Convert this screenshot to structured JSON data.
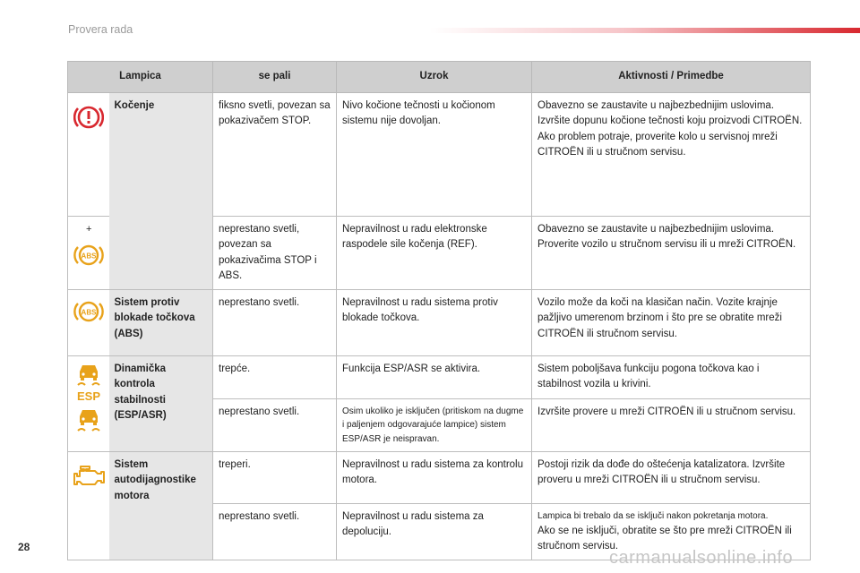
{
  "page": {
    "header_title": "Provera rada",
    "page_number": "28",
    "watermark": "carmanualsonline.info"
  },
  "table": {
    "headers": [
      "Lampica",
      "se pali",
      "Uzrok",
      "Aktivnosti / Primedbe"
    ],
    "brake": {
      "name": "Kočenje",
      "row1": {
        "se_pali": "fiksno svetli, povezan sa pokazivačem STOP.",
        "uzrok": "Nivo kočione tečnosti u kočionom sistemu nije dovoljan.",
        "aktivnosti": "Obavezno se zaustavite u najbezbednijim uslovima. Izvršite dopunu kočione tečnosti koju proizvodi CITROËN. Ako problem potraje, proverite kolo u servisnoj mreži CITROËN ili u stručnom servisu."
      },
      "plus": "+",
      "row2": {
        "se_pali": "neprestano svetli, povezan sa pokazivačima STOP i ABS.",
        "uzrok": "Nepravilnost u radu elektronske raspodele sile kočenja (REF).",
        "aktivnosti": "Obavezno se zaustavite u najbezbednijim uslovima. Proverite vozilo u stručnom servisu ili u mreži CITROËN."
      }
    },
    "abs": {
      "name": "Sistem protiv blokade točkova (ABS)",
      "se_pali": "neprestano svetli.",
      "uzrok": "Nepravilnost u radu sistema protiv blokade točkova.",
      "aktivnosti": "Vozilo može da koči na klasičan način. Vozite krajnje pažljivo umerenom brzinom i što pre se obratite mreži CITROËN ili stručnom servisu."
    },
    "esp": {
      "name": "Dinamička kontrola stabilnosti (ESP/ASR)",
      "icon_label": "ESP",
      "row1": {
        "se_pali": "trepće.",
        "uzrok": "Funkcija ESP/ASR se aktivira.",
        "aktivnosti": "Sistem poboljšava funkciju pogona točkova kao i stabilnost vozila u krivini."
      },
      "row2": {
        "se_pali": "neprestano svetli.",
        "uzrok": "Osim ukoliko je isključen (pritiskom na dugme i paljenjem odgovarajuće lampice) sistem ESP/ASR je neispravan.",
        "aktivnosti": "Izvršite provere u mreži CITROËN ili u stručnom servisu."
      }
    },
    "engine": {
      "name": "Sistem autodijagnostike motora",
      "row1": {
        "se_pali": "treperi.",
        "uzrok": "Nepravilnost u radu sistema za kontrolu motora.",
        "aktivnosti": "Postoji rizik da dođe do oštećenja katalizatora. Izvršite proveru u mreži CITROËN ili u stručnom servisu."
      },
      "row2": {
        "se_pali": "neprestano svetli.",
        "uzrok": "Nepravilnost u radu sistema za depoluciju.",
        "aktivnosti_small": "Lampica bi trebalo da se isključi nakon pokretanja motora.",
        "aktivnosti": "Ako se ne isključi, obratite se što pre mreži CITROËN ili stručnom servisu."
      }
    }
  },
  "colors": {
    "warning_red": "#d8282f",
    "amber": "#e8a21a",
    "header_gray": "#cfcfcf",
    "lamp_gray": "#e6e6e6"
  }
}
